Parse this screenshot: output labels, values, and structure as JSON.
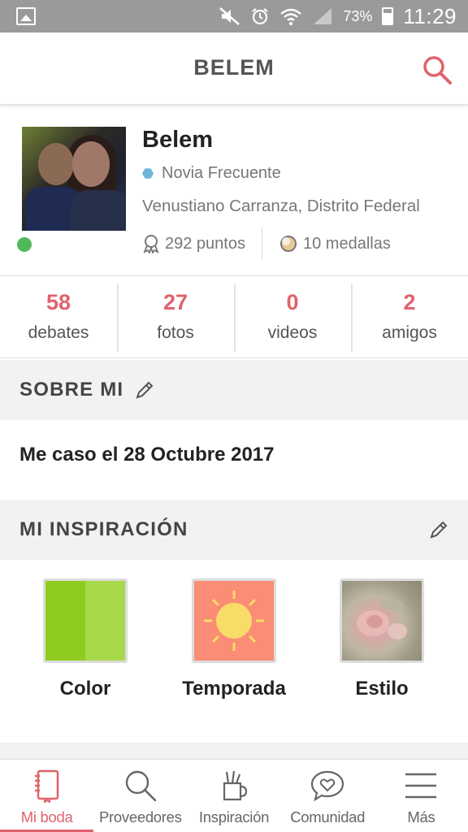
{
  "status_bar": {
    "battery_percent": "73%",
    "time": "11:29",
    "battery_level": 0.73,
    "icons": [
      "gallery-icon",
      "mute-icon",
      "alarm-icon",
      "wifi-icon",
      "signal-icon",
      "battery-icon"
    ]
  },
  "header": {
    "title": "BELEM",
    "search_icon": "search-icon"
  },
  "profile": {
    "name": "Belem",
    "role": "Novia Frecuente",
    "location": "Venustiano Carranza, Distrito Federal",
    "points": "292 puntos",
    "medals": "10 medallas",
    "online": true
  },
  "counters": [
    {
      "value": "58",
      "label": "debates"
    },
    {
      "value": "27",
      "label": "fotos"
    },
    {
      "value": "0",
      "label": "videos"
    },
    {
      "value": "2",
      "label": "amigos"
    }
  ],
  "about": {
    "title": "SOBRE MI",
    "text": "Me caso el 28 Octubre 2017"
  },
  "inspiration": {
    "title": "MI INSPIRACIÓN",
    "items": [
      {
        "label": "Color"
      },
      {
        "label": "Temporada"
      },
      {
        "label": "Estilo"
      }
    ]
  },
  "bottom_nav": [
    {
      "label": "Mi boda",
      "icon": "notebook-icon",
      "active": true
    },
    {
      "label": "Proveedores",
      "icon": "search-icon",
      "active": false
    },
    {
      "label": "Inspiración",
      "icon": "pencil-cup-icon",
      "active": false
    },
    {
      "label": "Comunidad",
      "icon": "heart-chat-icon",
      "active": false
    },
    {
      "label": "Más",
      "icon": "menu-icon",
      "active": false
    }
  ],
  "colors": {
    "accent": "#e0636b",
    "online": "#52b95a",
    "role_badge": "#6cb7d8",
    "section_bg": "#f2f2f2"
  }
}
